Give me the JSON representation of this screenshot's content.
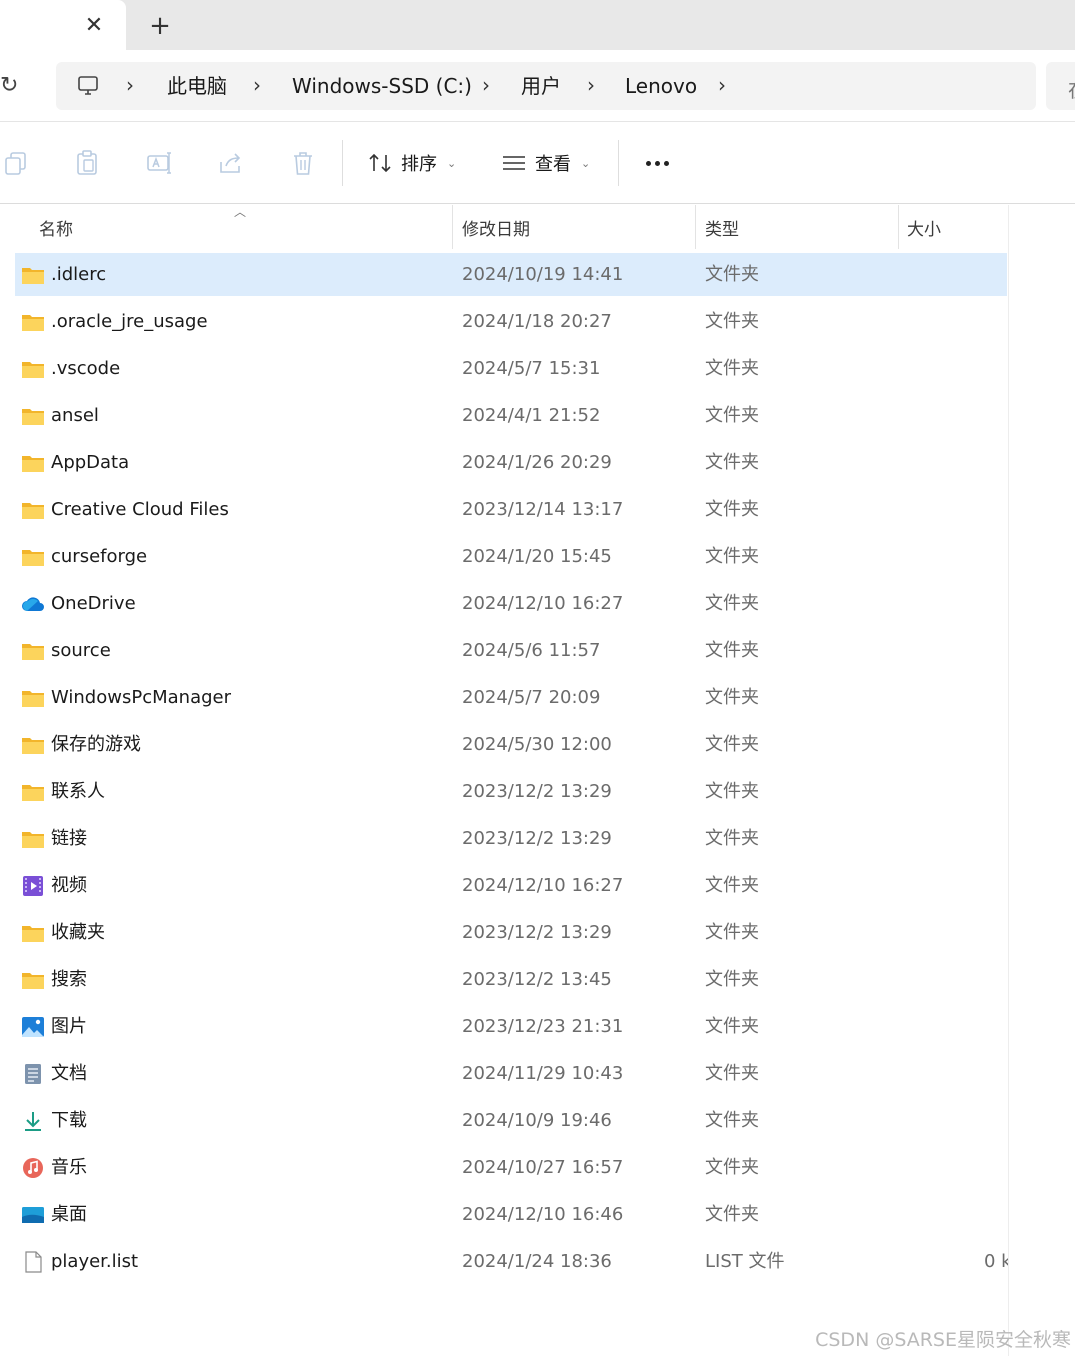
{
  "tab": {
    "close_glyph": "✕",
    "new_tab_glyph": "+"
  },
  "address": {
    "refresh_glyph": "↻",
    "crumbs": [
      "此电脑",
      "Windows-SSD (C:)",
      "用户",
      "Lenovo"
    ],
    "separator": "›",
    "search_glyph": "在"
  },
  "toolbar": {
    "sort_label": "排序",
    "view_label": "查看",
    "icons": [
      "copy-icon",
      "paste-icon",
      "rename-icon",
      "share-icon",
      "delete-icon"
    ]
  },
  "columns": {
    "name": "名称",
    "date": "修改日期",
    "type": "类型",
    "size": "大小"
  },
  "colors": {
    "folder": "#f7c843",
    "selected": "#dcecfc",
    "accent": "#0067c0"
  },
  "files": [
    {
      "name": ".idlerc",
      "date": "2024/10/19 14:41",
      "type": "文件夹",
      "size": "",
      "icon": "folder-icon",
      "selected": true
    },
    {
      "name": ".oracle_jre_usage",
      "date": "2024/1/18 20:27",
      "type": "文件夹",
      "size": "",
      "icon": "folder-icon"
    },
    {
      "name": ".vscode",
      "date": "2024/5/7 15:31",
      "type": "文件夹",
      "size": "",
      "icon": "folder-icon"
    },
    {
      "name": "ansel",
      "date": "2024/4/1 21:52",
      "type": "文件夹",
      "size": "",
      "icon": "folder-icon"
    },
    {
      "name": "AppData",
      "date": "2024/1/26 20:29",
      "type": "文件夹",
      "size": "",
      "icon": "folder-icon"
    },
    {
      "name": "Creative Cloud Files",
      "date": "2023/12/14 13:17",
      "type": "文件夹",
      "size": "",
      "icon": "folder-icon"
    },
    {
      "name": "curseforge",
      "date": "2024/1/20 15:45",
      "type": "文件夹",
      "size": "",
      "icon": "folder-icon"
    },
    {
      "name": "OneDrive",
      "date": "2024/12/10 16:27",
      "type": "文件夹",
      "size": "",
      "icon": "onedrive-cloud-icon"
    },
    {
      "name": "source",
      "date": "2024/5/6 11:57",
      "type": "文件夹",
      "size": "",
      "icon": "folder-icon"
    },
    {
      "name": "WindowsPcManager",
      "date": "2024/5/7 20:09",
      "type": "文件夹",
      "size": "",
      "icon": "folder-icon"
    },
    {
      "name": "保存的游戏",
      "date": "2024/5/30 12:00",
      "type": "文件夹",
      "size": "",
      "icon": "folder-icon"
    },
    {
      "name": "联系人",
      "date": "2023/12/2 13:29",
      "type": "文件夹",
      "size": "",
      "icon": "folder-icon"
    },
    {
      "name": "链接",
      "date": "2023/12/2 13:29",
      "type": "文件夹",
      "size": "",
      "icon": "folder-icon"
    },
    {
      "name": "视频",
      "date": "2024/12/10 16:27",
      "type": "文件夹",
      "size": "",
      "icon": "videos-icon"
    },
    {
      "name": "收藏夹",
      "date": "2023/12/2 13:29",
      "type": "文件夹",
      "size": "",
      "icon": "folder-icon"
    },
    {
      "name": "搜索",
      "date": "2023/12/2 13:45",
      "type": "文件夹",
      "size": "",
      "icon": "folder-icon"
    },
    {
      "name": "图片",
      "date": "2023/12/23 21:31",
      "type": "文件夹",
      "size": "",
      "icon": "pictures-icon"
    },
    {
      "name": "文档",
      "date": "2024/11/29 10:43",
      "type": "文件夹",
      "size": "",
      "icon": "documents-icon"
    },
    {
      "name": "下载",
      "date": "2024/10/9 19:46",
      "type": "文件夹",
      "size": "",
      "icon": "downloads-icon"
    },
    {
      "name": "音乐",
      "date": "2024/10/27 16:57",
      "type": "文件夹",
      "size": "",
      "icon": "music-icon"
    },
    {
      "name": "桌面",
      "date": "2024/12/10 16:46",
      "type": "文件夹",
      "size": "",
      "icon": "desktop-icon"
    },
    {
      "name": "player.list",
      "date": "2024/1/24 18:36",
      "type": "LIST 文件",
      "size": "0 k",
      "icon": "file-icon"
    }
  ],
  "watermark": "CSDN @SARSE星陨安全秋寒"
}
